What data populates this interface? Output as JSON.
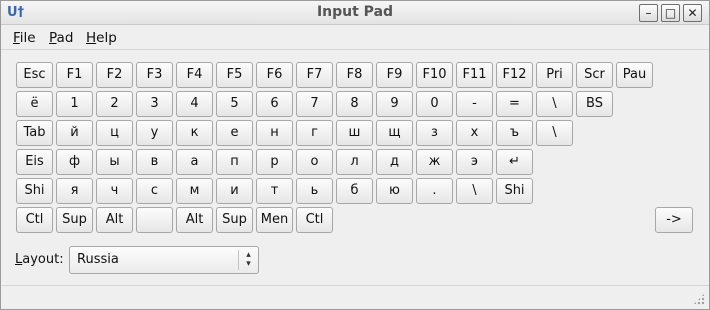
{
  "window": {
    "title": "Input Pad",
    "app_icon": "U†",
    "minimize_glyph": "–",
    "maximize_glyph": "□",
    "close_glyph": "✕"
  },
  "menu": {
    "file": {
      "accel": "F",
      "rest": "ile"
    },
    "pad": {
      "accel": "P",
      "rest": "ad"
    },
    "help": {
      "accel": "H",
      "rest": "elp"
    }
  },
  "keyboard": {
    "rows": [
      [
        "Esc",
        "F1",
        "F2",
        "F3",
        "F4",
        "F5",
        "F6",
        "F7",
        "F8",
        "F9",
        "F10",
        "F11",
        "F12",
        "Pri",
        "Scr",
        "Pau"
      ],
      [
        "ё",
        "1",
        "2",
        "3",
        "4",
        "5",
        "6",
        "7",
        "8",
        "9",
        "0",
        "-",
        "=",
        "\\",
        "BS"
      ],
      [
        "Tab",
        "й",
        "ц",
        "у",
        "к",
        "е",
        "н",
        "г",
        "ш",
        "щ",
        "з",
        "х",
        "ъ",
        "\\"
      ],
      [
        "Eis",
        "ф",
        "ы",
        "в",
        "а",
        "п",
        "р",
        "о",
        "л",
        "д",
        "ж",
        "э",
        "↵"
      ],
      [
        "Shi",
        "я",
        "ч",
        "с",
        "м",
        "и",
        "т",
        "ь",
        "б",
        "ю",
        ".",
        "\\",
        "Shi"
      ],
      [
        "Ctl",
        "Sup",
        "Alt",
        "",
        "Alt",
        "Sup",
        "Men",
        "Ctl"
      ]
    ],
    "arrow_key": "->"
  },
  "layout": {
    "label_accel": "L",
    "label_rest": "ayout:",
    "value": "Russia",
    "arrow_up": "▴",
    "arrow_down": "▾"
  }
}
